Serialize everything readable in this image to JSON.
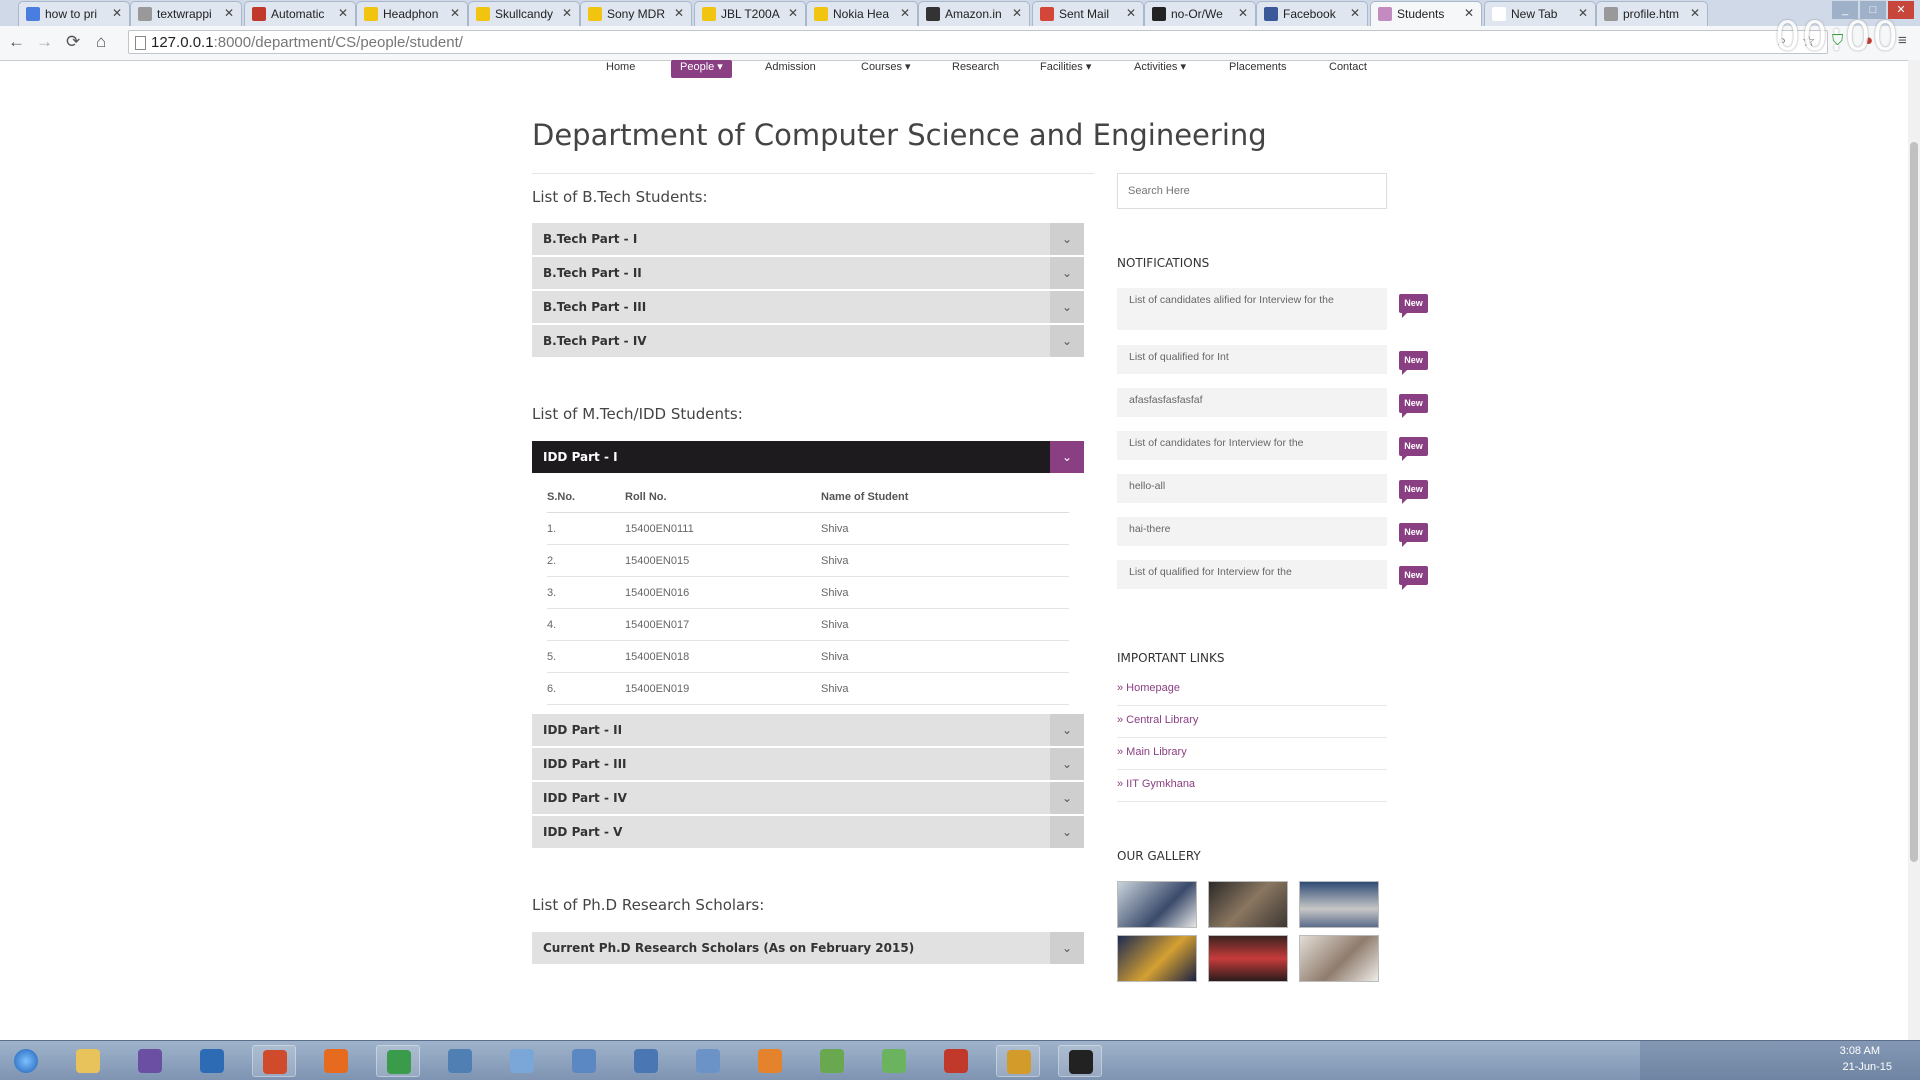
{
  "browser": {
    "tabs": [
      {
        "title": "how to pri",
        "icon": "google-icon",
        "color": "#4a7de0"
      },
      {
        "title": "textwrappi",
        "icon": "page-icon",
        "color": "#999999"
      },
      {
        "title": "Automatic",
        "icon": "as-icon",
        "color": "#c0392b"
      },
      {
        "title": "Headphon",
        "icon": "flipkart-icon",
        "color": "#f1c40f"
      },
      {
        "title": "Skullcandy",
        "icon": "flipkart-icon",
        "color": "#f1c40f"
      },
      {
        "title": "Sony MDR",
        "icon": "flipkart-icon",
        "color": "#f1c40f"
      },
      {
        "title": "JBL T200A",
        "icon": "flipkart-icon",
        "color": "#f1c40f"
      },
      {
        "title": "Nokia Hea",
        "icon": "flipkart-icon",
        "color": "#f1c40f"
      },
      {
        "title": "Amazon.in",
        "icon": "amazon-icon",
        "color": "#333333"
      },
      {
        "title": "Sent Mail",
        "icon": "gmail-icon",
        "color": "#d44638"
      },
      {
        "title": "no-Or/We",
        "icon": "github-icon",
        "color": "#222222"
      },
      {
        "title": "Facebook",
        "icon": "facebook-icon",
        "color": "#3b5998"
      },
      {
        "title": "Students",
        "icon": "site-icon",
        "color": "#c48bc0"
      },
      {
        "title": "New Tab",
        "icon": "none",
        "color": "#ffffff"
      },
      {
        "title": "profile.htm",
        "icon": "page-icon",
        "color": "#999999"
      }
    ],
    "active_tab": "Students",
    "url_host": "127.0.0.1",
    "url_rest": ":8000/department/CS/people/student/",
    "overlay_clock": "00:00"
  },
  "nav": {
    "items": [
      "Home",
      "People ▾",
      "Admission",
      "Courses ▾",
      "Research",
      "Facilities ▾",
      "Activities ▾",
      "Placements",
      "Contact"
    ],
    "active": "People ▾"
  },
  "page": {
    "title": "Department of Computer Science and Engineering",
    "btech_heading": "List of B.Tech Students:",
    "btech_items": [
      "B.Tech Part - I",
      "B.Tech Part - II",
      "B.Tech Part - III",
      "B.Tech Part - IV"
    ],
    "mtech_heading": "List of M.Tech/IDD Students:",
    "idd_open": "IDD Part - I",
    "table_headers": [
      "S.No.",
      "Roll No.",
      "Name of Student"
    ],
    "students": [
      [
        "1.",
        "15400EN0111",
        "Shiva"
      ],
      [
        "2.",
        "15400EN015",
        "Shiva"
      ],
      [
        "3.",
        "15400EN016",
        "Shiva"
      ],
      [
        "4.",
        "15400EN017",
        "Shiva"
      ],
      [
        "5.",
        "15400EN018",
        "Shiva"
      ],
      [
        "6.",
        "15400EN019",
        "Shiva"
      ]
    ],
    "idd_items": [
      "IDD Part - II",
      "IDD Part - III",
      "IDD Part - IV",
      "IDD Part - V"
    ],
    "phd_heading": "List of Ph.D Research Scholars:",
    "phd_item": "Current Ph.D Research Scholars (As on February 2015)"
  },
  "sidebar": {
    "search_placeholder": "Search Here",
    "notifications_heading": "NOTIFICATIONS",
    "badge": "New",
    "notifications": [
      "List of candidates alified for Interview for the",
      "List of qualified for Int",
      "afasfasfasfasfaf",
      "List of candidates for Interview for the",
      "hello-all",
      "hai-there",
      "List of qualified for Interview for the"
    ],
    "links_heading": "IMPORTANT LINKS",
    "links": [
      "» Homepage",
      "» Central Library",
      "» Main Library",
      "» IIT Gymkhana"
    ],
    "gallery_heading": "OUR GALLERY"
  },
  "taskbar": {
    "time": "3:08 AM",
    "date": "21-Jun-15"
  },
  "colors": {
    "accent": "#8a3f83",
    "accordion": "#e1e1e1",
    "accordion_open": "#1e1b1e"
  }
}
